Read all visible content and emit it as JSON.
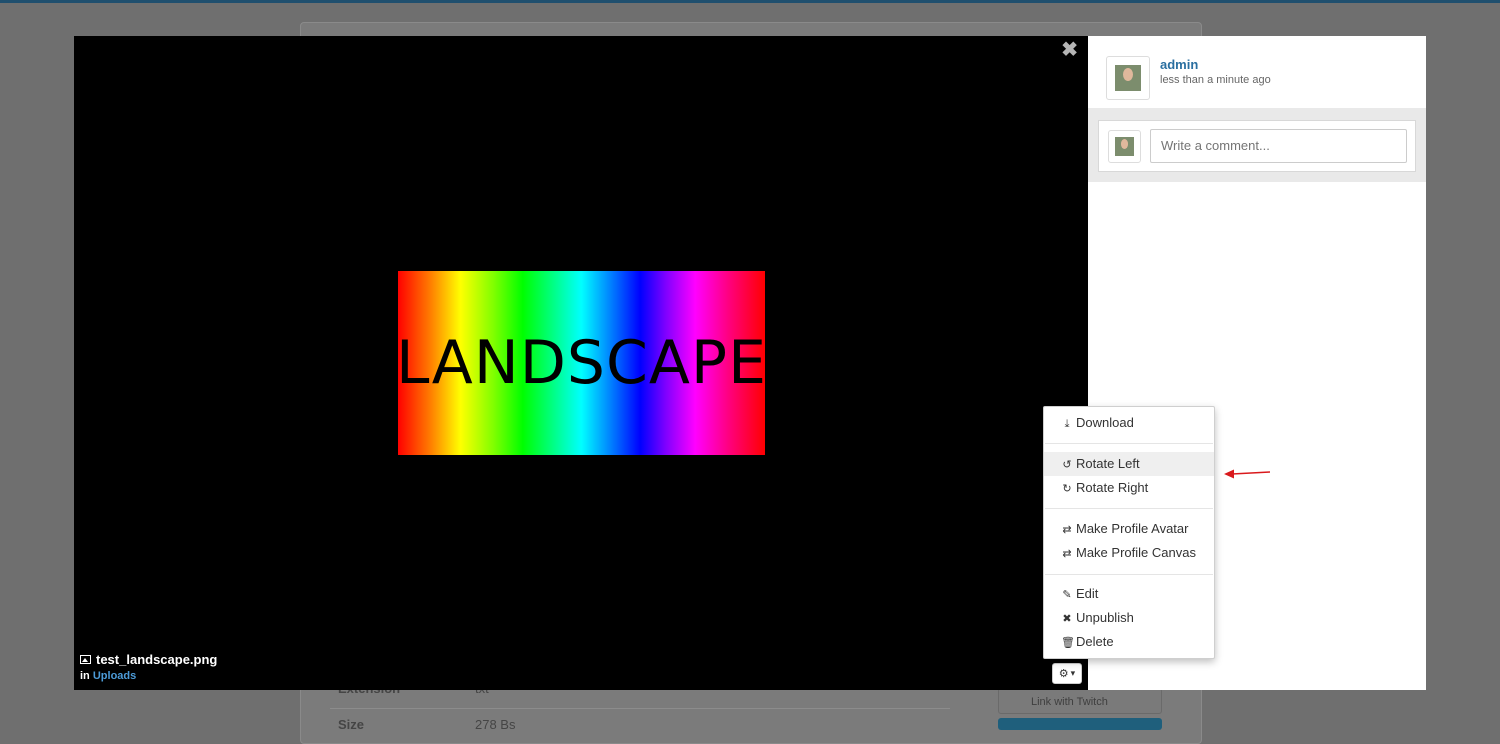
{
  "background": {
    "rows": [
      {
        "key": "Extension",
        "value": "txt"
      },
      {
        "key": "Size",
        "value": "278 Bs"
      }
    ],
    "link_button": "Link with Twitch"
  },
  "viewer": {
    "close_glyph": "✖",
    "image_text": "LANDSCAPE",
    "file_name": "test_landscape.png",
    "in_label": "in",
    "folder": "Uploads",
    "gear_glyph": "⚙",
    "caret_glyph": "▾"
  },
  "side": {
    "username": "admin",
    "time": "less than a minute ago",
    "comment_placeholder": "Write a comment..."
  },
  "menu": {
    "items": [
      {
        "label": "Download",
        "icon": "download-icon",
        "glyph": "⤓"
      },
      {
        "label": "Rotate Left",
        "icon": "rotate-left-icon",
        "glyph": "↺"
      },
      {
        "label": "Rotate Right",
        "icon": "rotate-right-icon",
        "glyph": "↻"
      },
      {
        "label": "Make Profile Avatar",
        "icon": "exchange-icon",
        "glyph": "⇄"
      },
      {
        "label": "Make Profile Canvas",
        "icon": "exchange-icon",
        "glyph": "⇄"
      },
      {
        "label": "Edit",
        "icon": "edit-icon",
        "glyph": "✎"
      },
      {
        "label": "Unpublish",
        "icon": "remove-circle-icon",
        "glyph": "✖"
      },
      {
        "label": "Delete",
        "icon": "trash-icon",
        "glyph": "🗑"
      }
    ]
  },
  "colors": {
    "annotation_arrow": "#d9191c",
    "link": "#2a6fa0"
  }
}
